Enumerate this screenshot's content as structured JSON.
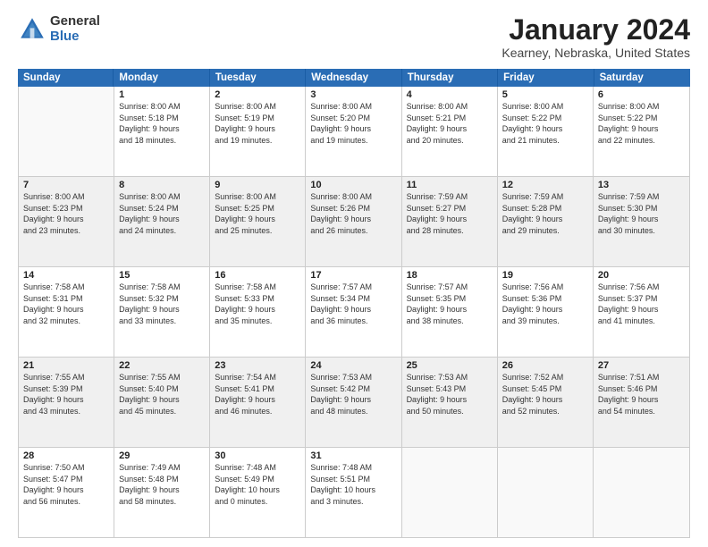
{
  "logo": {
    "general": "General",
    "blue": "Blue"
  },
  "title": {
    "month": "January 2024",
    "location": "Kearney, Nebraska, United States"
  },
  "header_days": [
    "Sunday",
    "Monday",
    "Tuesday",
    "Wednesday",
    "Thursday",
    "Friday",
    "Saturday"
  ],
  "weeks": [
    [
      {
        "day": "",
        "data": [],
        "empty": true
      },
      {
        "day": "1",
        "data": [
          "Sunrise: 8:00 AM",
          "Sunset: 5:18 PM",
          "Daylight: 9 hours",
          "and 18 minutes."
        ]
      },
      {
        "day": "2",
        "data": [
          "Sunrise: 8:00 AM",
          "Sunset: 5:19 PM",
          "Daylight: 9 hours",
          "and 19 minutes."
        ]
      },
      {
        "day": "3",
        "data": [
          "Sunrise: 8:00 AM",
          "Sunset: 5:20 PM",
          "Daylight: 9 hours",
          "and 19 minutes."
        ]
      },
      {
        "day": "4",
        "data": [
          "Sunrise: 8:00 AM",
          "Sunset: 5:21 PM",
          "Daylight: 9 hours",
          "and 20 minutes."
        ]
      },
      {
        "day": "5",
        "data": [
          "Sunrise: 8:00 AM",
          "Sunset: 5:22 PM",
          "Daylight: 9 hours",
          "and 21 minutes."
        ]
      },
      {
        "day": "6",
        "data": [
          "Sunrise: 8:00 AM",
          "Sunset: 5:22 PM",
          "Daylight: 9 hours",
          "and 22 minutes."
        ]
      }
    ],
    [
      {
        "day": "7",
        "data": [
          "Sunrise: 8:00 AM",
          "Sunset: 5:23 PM",
          "Daylight: 9 hours",
          "and 23 minutes."
        ],
        "shaded": true
      },
      {
        "day": "8",
        "data": [
          "Sunrise: 8:00 AM",
          "Sunset: 5:24 PM",
          "Daylight: 9 hours",
          "and 24 minutes."
        ],
        "shaded": true
      },
      {
        "day": "9",
        "data": [
          "Sunrise: 8:00 AM",
          "Sunset: 5:25 PM",
          "Daylight: 9 hours",
          "and 25 minutes."
        ],
        "shaded": true
      },
      {
        "day": "10",
        "data": [
          "Sunrise: 8:00 AM",
          "Sunset: 5:26 PM",
          "Daylight: 9 hours",
          "and 26 minutes."
        ],
        "shaded": true
      },
      {
        "day": "11",
        "data": [
          "Sunrise: 7:59 AM",
          "Sunset: 5:27 PM",
          "Daylight: 9 hours",
          "and 28 minutes."
        ],
        "shaded": true
      },
      {
        "day": "12",
        "data": [
          "Sunrise: 7:59 AM",
          "Sunset: 5:28 PM",
          "Daylight: 9 hours",
          "and 29 minutes."
        ],
        "shaded": true
      },
      {
        "day": "13",
        "data": [
          "Sunrise: 7:59 AM",
          "Sunset: 5:30 PM",
          "Daylight: 9 hours",
          "and 30 minutes."
        ],
        "shaded": true
      }
    ],
    [
      {
        "day": "14",
        "data": [
          "Sunrise: 7:58 AM",
          "Sunset: 5:31 PM",
          "Daylight: 9 hours",
          "and 32 minutes."
        ]
      },
      {
        "day": "15",
        "data": [
          "Sunrise: 7:58 AM",
          "Sunset: 5:32 PM",
          "Daylight: 9 hours",
          "and 33 minutes."
        ]
      },
      {
        "day": "16",
        "data": [
          "Sunrise: 7:58 AM",
          "Sunset: 5:33 PM",
          "Daylight: 9 hours",
          "and 35 minutes."
        ]
      },
      {
        "day": "17",
        "data": [
          "Sunrise: 7:57 AM",
          "Sunset: 5:34 PM",
          "Daylight: 9 hours",
          "and 36 minutes."
        ]
      },
      {
        "day": "18",
        "data": [
          "Sunrise: 7:57 AM",
          "Sunset: 5:35 PM",
          "Daylight: 9 hours",
          "and 38 minutes."
        ]
      },
      {
        "day": "19",
        "data": [
          "Sunrise: 7:56 AM",
          "Sunset: 5:36 PM",
          "Daylight: 9 hours",
          "and 39 minutes."
        ]
      },
      {
        "day": "20",
        "data": [
          "Sunrise: 7:56 AM",
          "Sunset: 5:37 PM",
          "Daylight: 9 hours",
          "and 41 minutes."
        ]
      }
    ],
    [
      {
        "day": "21",
        "data": [
          "Sunrise: 7:55 AM",
          "Sunset: 5:39 PM",
          "Daylight: 9 hours",
          "and 43 minutes."
        ],
        "shaded": true
      },
      {
        "day": "22",
        "data": [
          "Sunrise: 7:55 AM",
          "Sunset: 5:40 PM",
          "Daylight: 9 hours",
          "and 45 minutes."
        ],
        "shaded": true
      },
      {
        "day": "23",
        "data": [
          "Sunrise: 7:54 AM",
          "Sunset: 5:41 PM",
          "Daylight: 9 hours",
          "and 46 minutes."
        ],
        "shaded": true
      },
      {
        "day": "24",
        "data": [
          "Sunrise: 7:53 AM",
          "Sunset: 5:42 PM",
          "Daylight: 9 hours",
          "and 48 minutes."
        ],
        "shaded": true
      },
      {
        "day": "25",
        "data": [
          "Sunrise: 7:53 AM",
          "Sunset: 5:43 PM",
          "Daylight: 9 hours",
          "and 50 minutes."
        ],
        "shaded": true
      },
      {
        "day": "26",
        "data": [
          "Sunrise: 7:52 AM",
          "Sunset: 5:45 PM",
          "Daylight: 9 hours",
          "and 52 minutes."
        ],
        "shaded": true
      },
      {
        "day": "27",
        "data": [
          "Sunrise: 7:51 AM",
          "Sunset: 5:46 PM",
          "Daylight: 9 hours",
          "and 54 minutes."
        ],
        "shaded": true
      }
    ],
    [
      {
        "day": "28",
        "data": [
          "Sunrise: 7:50 AM",
          "Sunset: 5:47 PM",
          "Daylight: 9 hours",
          "and 56 minutes."
        ]
      },
      {
        "day": "29",
        "data": [
          "Sunrise: 7:49 AM",
          "Sunset: 5:48 PM",
          "Daylight: 9 hours",
          "and 58 minutes."
        ]
      },
      {
        "day": "30",
        "data": [
          "Sunrise: 7:48 AM",
          "Sunset: 5:49 PM",
          "Daylight: 10 hours",
          "and 0 minutes."
        ]
      },
      {
        "day": "31",
        "data": [
          "Sunrise: 7:48 AM",
          "Sunset: 5:51 PM",
          "Daylight: 10 hours",
          "and 3 minutes."
        ]
      },
      {
        "day": "",
        "data": [],
        "empty": true
      },
      {
        "day": "",
        "data": [],
        "empty": true
      },
      {
        "day": "",
        "data": [],
        "empty": true
      }
    ]
  ]
}
